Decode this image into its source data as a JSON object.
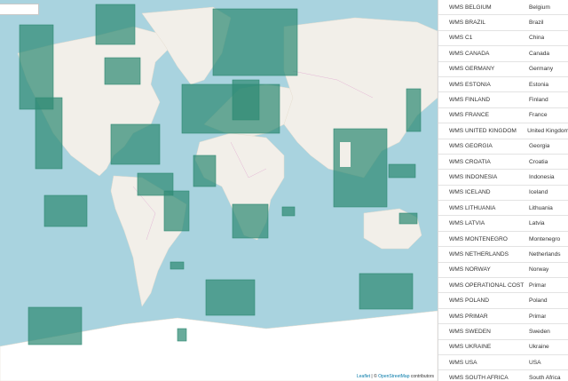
{
  "map": {
    "attribution_leaflet": "Leaflet",
    "attribution_sep": " | © ",
    "attribution_osm": "OpenStreetMap",
    "attribution_suffix": " contributors",
    "colors": {
      "water": "#a9d3df",
      "land": "#f2efe9",
      "ice": "#ffffff",
      "coverage": "#2f8a74",
      "border": "#e0a8d0"
    }
  },
  "layers": [
    {
      "name": "WMS BELGIUM",
      "country": "Belgium"
    },
    {
      "name": "WMS BRAZIL",
      "country": "Brazil"
    },
    {
      "name": "WMS C1",
      "country": "China"
    },
    {
      "name": "WMS CANADA",
      "country": "Canada"
    },
    {
      "name": "WMS GERMANY",
      "country": "Germany"
    },
    {
      "name": "WMS ESTONIA",
      "country": "Estonia"
    },
    {
      "name": "WMS FINLAND",
      "country": "Finland"
    },
    {
      "name": "WMS FRANCE",
      "country": "France"
    },
    {
      "name": "WMS UNITED KINGDOM",
      "country": "United Kingdom"
    },
    {
      "name": "WMS GEORGIA",
      "country": "Georgia"
    },
    {
      "name": "WMS CROATIA",
      "country": "Croatia"
    },
    {
      "name": "WMS INDONESIA",
      "country": "Indonesia"
    },
    {
      "name": "WMS ICELAND",
      "country": "Iceland"
    },
    {
      "name": "WMS LITHUANIA",
      "country": "Lithuania"
    },
    {
      "name": "WMS LATVIA",
      "country": "Latvia"
    },
    {
      "name": "WMS MONTENEGRO",
      "country": "Montenegro"
    },
    {
      "name": "WMS NETHERLANDS",
      "country": "Netherlands"
    },
    {
      "name": "WMS NORWAY",
      "country": "Norway"
    },
    {
      "name": "WMS OPERATIONAL COST",
      "country": "Primar"
    },
    {
      "name": "WMS POLAND",
      "country": "Poland"
    },
    {
      "name": "WMS PRIMAR",
      "country": "Primar"
    },
    {
      "name": "WMS SWEDEN",
      "country": "Sweden"
    },
    {
      "name": "WMS UKRAINE",
      "country": "Ukraine"
    },
    {
      "name": "WMS USA",
      "country": "USA"
    },
    {
      "name": "WMS SOUTH AFRICA",
      "country": "South Africa"
    }
  ]
}
